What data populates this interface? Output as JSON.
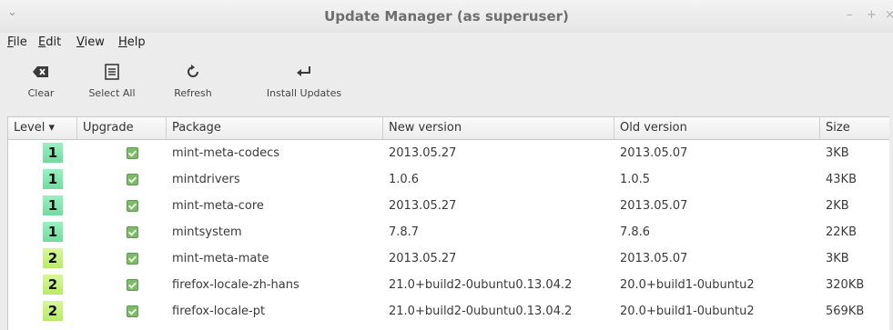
{
  "window": {
    "title": "Update Manager (as superuser)",
    "menu_glyph": "⌄",
    "min_glyph": "–",
    "max_glyph": "+",
    "close_glyph": "×"
  },
  "menubar": [
    {
      "acc": "F",
      "rest": "ile"
    },
    {
      "acc": "E",
      "rest": "dit"
    },
    {
      "acc": "V",
      "rest": "iew"
    },
    {
      "acc": "H",
      "rest": "elp"
    }
  ],
  "toolbar": {
    "clear": "Clear",
    "select_all": "Select All",
    "refresh": "Refresh",
    "install": "Install Updates"
  },
  "columns": {
    "level": "Level ▾",
    "upgrade": "Upgrade",
    "package": "Package",
    "new_version": "New version",
    "old_version": "Old version",
    "size": "Size"
  },
  "rows": [
    {
      "level": "1",
      "package": "mint-meta-codecs",
      "new": "2013.05.27",
      "old": "2013.05.07",
      "size": "3KB",
      "checked": true
    },
    {
      "level": "1",
      "package": "mintdrivers",
      "new": "1.0.6",
      "old": "1.0.5",
      "size": "43KB",
      "checked": true
    },
    {
      "level": "1",
      "package": "mint-meta-core",
      "new": "2013.05.27",
      "old": "2013.05.07",
      "size": "2KB",
      "checked": true
    },
    {
      "level": "1",
      "package": "mintsystem",
      "new": "7.8.7",
      "old": "7.8.6",
      "size": "22KB",
      "checked": true
    },
    {
      "level": "2",
      "package": "mint-meta-mate",
      "new": "2013.05.27",
      "old": "2013.05.07",
      "size": "3KB",
      "checked": true
    },
    {
      "level": "2",
      "package": "firefox-locale-zh-hans",
      "new": "21.0+build2-0ubuntu0.13.04.2",
      "old": "20.0+build1-0ubuntu2",
      "size": "320KB",
      "checked": true
    },
    {
      "level": "2",
      "package": "firefox-locale-pt",
      "new": "21.0+build2-0ubuntu0.13.04.2",
      "old": "20.0+build1-0ubuntu2",
      "size": "569KB",
      "checked": true
    }
  ],
  "colors": {
    "level1": "#7fe3aa",
    "level2": "#c6ef7a",
    "checkbox": "#7dbb6a"
  }
}
